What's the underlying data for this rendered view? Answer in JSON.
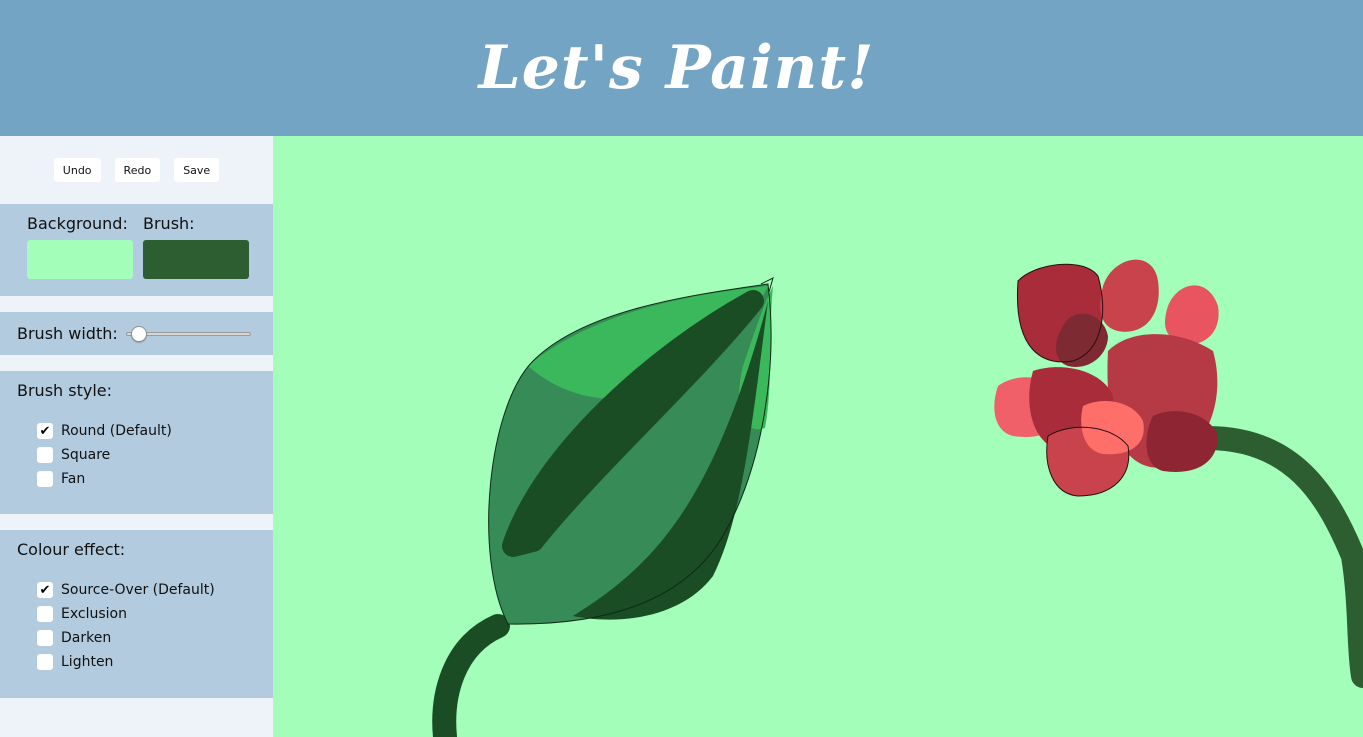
{
  "header": {
    "title": "Let's Paint!"
  },
  "toolbar": {
    "undo": "Undo",
    "redo": "Redo",
    "save": "Save"
  },
  "colors": {
    "background_label": "Background:",
    "brush_label": "Brush:",
    "background_value": "#a3feba",
    "brush_value": "#2c5e31"
  },
  "brush_width": {
    "label": "Brush width:",
    "value_fraction": 0.05
  },
  "brush_style": {
    "title": "Brush style:",
    "options": [
      {
        "label": "Round (Default)",
        "checked": true
      },
      {
        "label": "Square",
        "checked": false
      },
      {
        "label": "Fan",
        "checked": false
      }
    ]
  },
  "colour_effect": {
    "title": "Colour effect:",
    "options": [
      {
        "label": "Source-Over (Default)",
        "checked": true
      },
      {
        "label": "Exclusion",
        "checked": false
      },
      {
        "label": "Darken",
        "checked": false
      },
      {
        "label": "Lighten",
        "checked": false
      }
    ]
  },
  "canvas": {
    "background": "#a3feba",
    "drawing": "painted green leaf bud with dark stem and red flower with curved stem"
  }
}
